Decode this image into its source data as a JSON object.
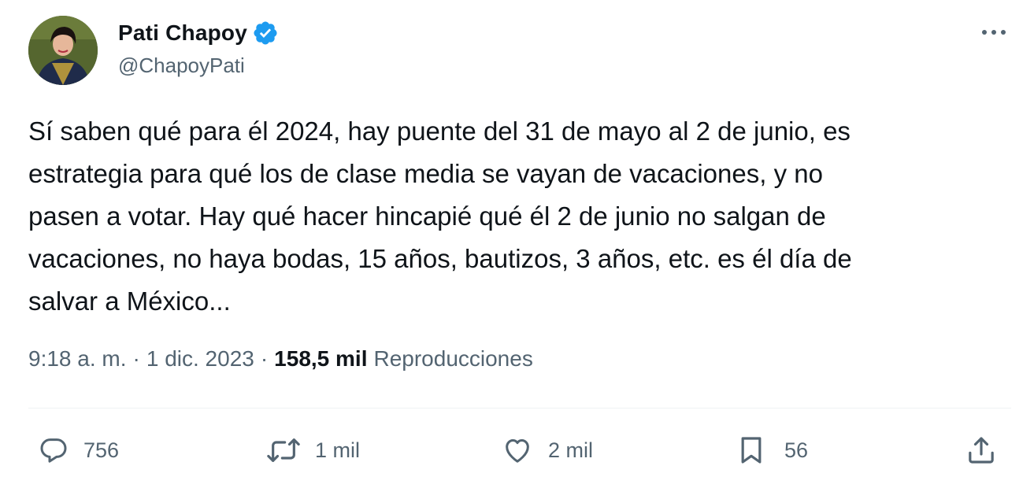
{
  "author": {
    "display_name": "Pati Chapoy",
    "handle": "@ChapoyPati",
    "verified_icon": "verified-badge-icon"
  },
  "tweet": {
    "text": "Sí saben qué para él 2024, hay puente del 31 de mayo al 2 de junio, es\nestrategia para qué los de clase media se vayan de vacaciones, y no\npasen a votar. Hay qué hacer hincapié qué él 2 de junio no salgan de\nvacaciones, no haya bodas, 15 años, bautizos, 3 años, etc. es él día de\nsalvar a México..."
  },
  "meta": {
    "time": "9:18 a. m.",
    "separator": "·",
    "date": "1 dic. 2023",
    "views_count": "158,5 mil",
    "views_label": "Reproducciones"
  },
  "actions": {
    "replies": "756",
    "retweets": "1 mil",
    "likes": "2 mil",
    "bookmarks": "56"
  },
  "colors": {
    "text": "#0f1419",
    "secondary": "#536471",
    "verified": "#1d9bf0",
    "divider": "#eff3f4"
  }
}
